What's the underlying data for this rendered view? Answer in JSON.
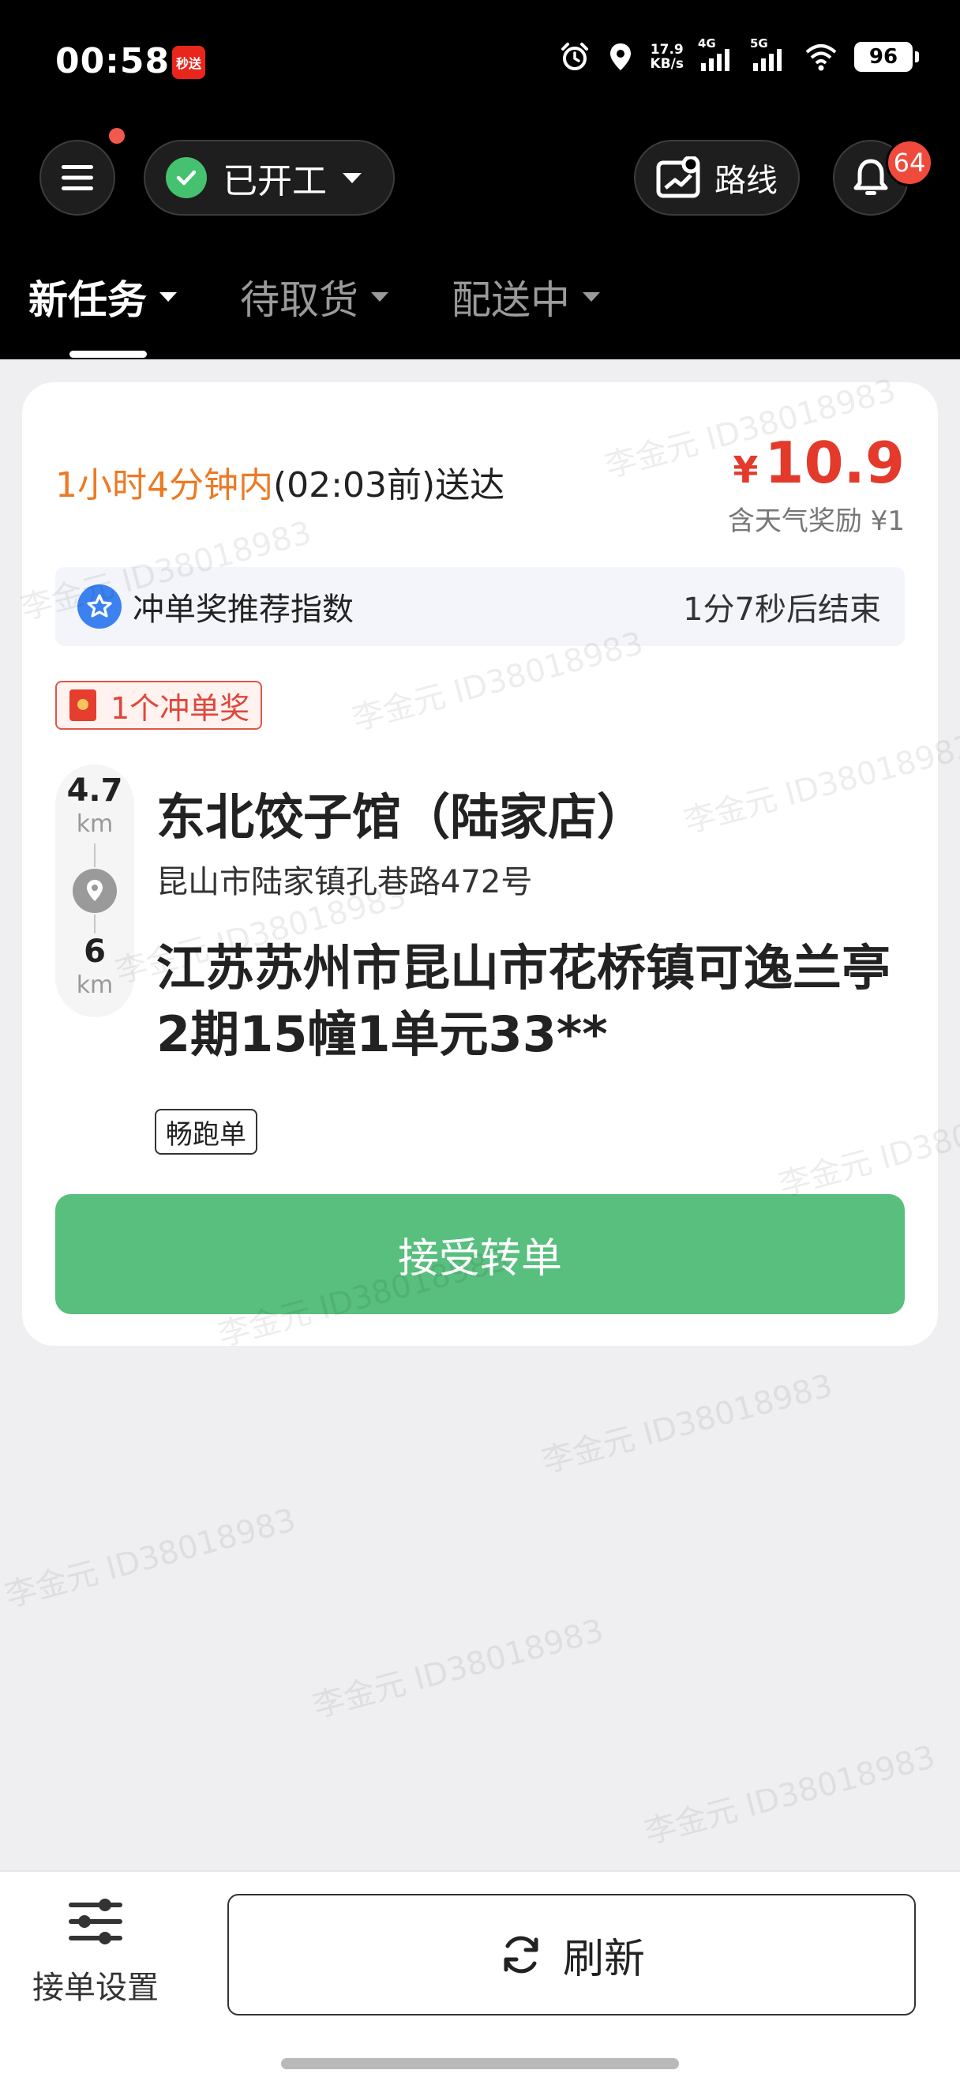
{
  "status_bar": {
    "time": "00:58",
    "app_badge": "秒送",
    "netspeed_value": "17.9",
    "netspeed_unit": "KB/s",
    "signal1": "4G",
    "signal2": "5G",
    "battery": "96"
  },
  "header": {
    "work_status": "已开工",
    "route_label": "路线",
    "notification_count": "64"
  },
  "tabs": [
    {
      "label": "新任务",
      "active": true
    },
    {
      "label": "待取货",
      "active": false
    },
    {
      "label": "配送中",
      "active": false
    }
  ],
  "order": {
    "deliver_time_highlight": "1小时4分钟内",
    "deliver_time_rest": "(02:03前)送达",
    "currency": "¥",
    "price": "10.9",
    "weather_bonus": "含天气奖励 ¥1",
    "boost_label": "冲单奖推荐指数",
    "boost_countdown": "1分7秒后结束",
    "bonus_tag": "1个冲单奖",
    "pickup_distance": "4.7",
    "pickup_unit": "km",
    "delivery_distance": "6",
    "delivery_unit": "km",
    "shop_name": "东北饺子馆（陆家店）",
    "shop_address": "昆山市陆家镇孔巷路472号",
    "destination_address": "江苏苏州市昆山市花桥镇可逸兰亭2期15幢1单元33**",
    "order_tag": "畅跑单",
    "accept_button": "接受转单"
  },
  "watermark": "李金元 ID38018983",
  "bottom_bar": {
    "settings_label": "接单设置",
    "refresh_label": "刷新"
  },
  "colors": {
    "accent_green": "#58bf7e",
    "price_red": "#e33a2b",
    "time_orange": "#ec7a24"
  }
}
